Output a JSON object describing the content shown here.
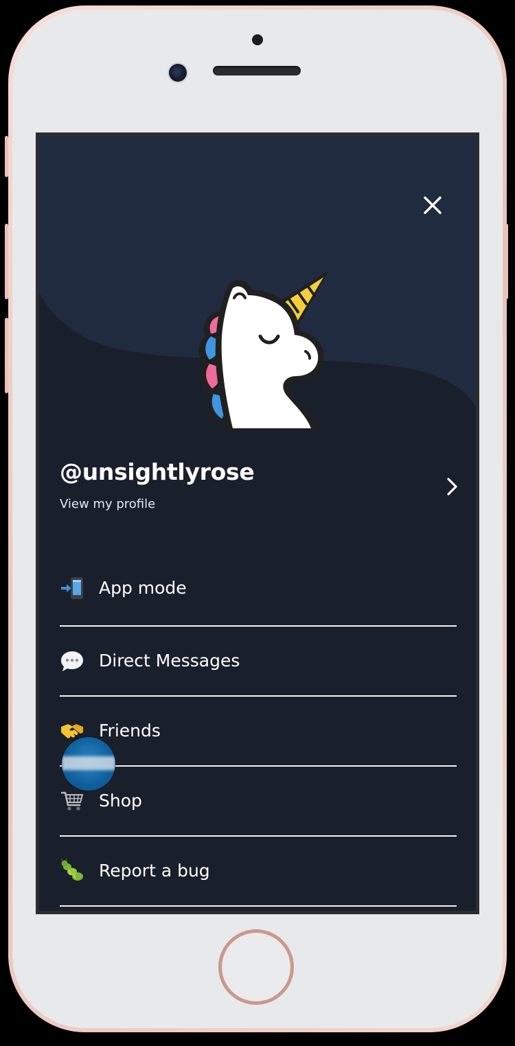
{
  "device": {
    "frame_color": "#f1d2cb",
    "bezel_color": "#e8e9eb"
  },
  "screen": {
    "background_color": "#1a1f2c",
    "header_wave_color": "#212b3f"
  },
  "header": {
    "close_icon": "close-icon"
  },
  "profile": {
    "avatar_icon": "unicorn-icon",
    "username": "@unsightlyrose",
    "link_label": "View my profile",
    "chevron_icon": "chevron-right-icon"
  },
  "menu": {
    "items": [
      {
        "label": "App mode",
        "icon": "mobile-phone-arrow-icon"
      },
      {
        "label": "Direct Messages",
        "icon": "speech-bubble-icon"
      },
      {
        "label": "Friends",
        "icon": "handshake-icon"
      },
      {
        "label": "Shop",
        "icon": "shopping-cart-icon"
      },
      {
        "label": "Report a bug",
        "icon": "bug-icon"
      }
    ]
  },
  "overlay": {
    "touch_indicator_icon": "touch-indicator-icon"
  }
}
